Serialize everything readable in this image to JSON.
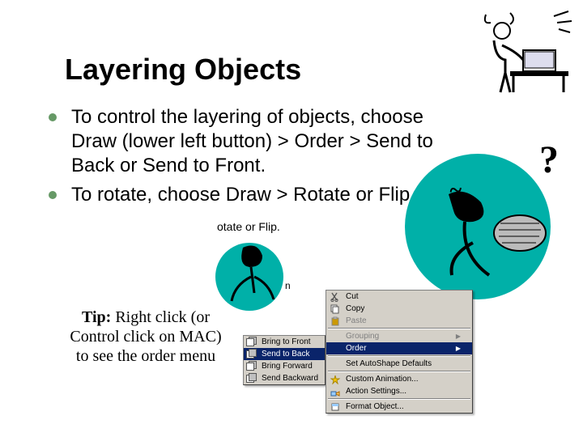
{
  "title": "Layering Objects",
  "bullets": [
    "To control the layering of objects, choose Draw (lower left button) > Order > Send to Back or  Send to Front.",
    "To rotate, choose Draw > Rotate or Flip."
  ],
  "tip": {
    "label": "Tip:",
    "text": " Right click (or Control click on MAC) to see the order menu"
  },
  "fragment_caption": "otate or Flip.",
  "fragment_n": "n",
  "context_menu": {
    "cut": "Cut",
    "copy": "Copy",
    "paste": "Paste",
    "grouping": "Grouping",
    "order": "Order",
    "set_defaults": "Set AutoShape Defaults",
    "custom_anim": "Custom Animation...",
    "action_settings": "Action Settings...",
    "format": "Format Object..."
  },
  "order_submenu": {
    "bring_front": "Bring to Front",
    "send_back": "Send to Back",
    "bring_forward": "Bring Forward",
    "send_backward": "Send Backward"
  }
}
